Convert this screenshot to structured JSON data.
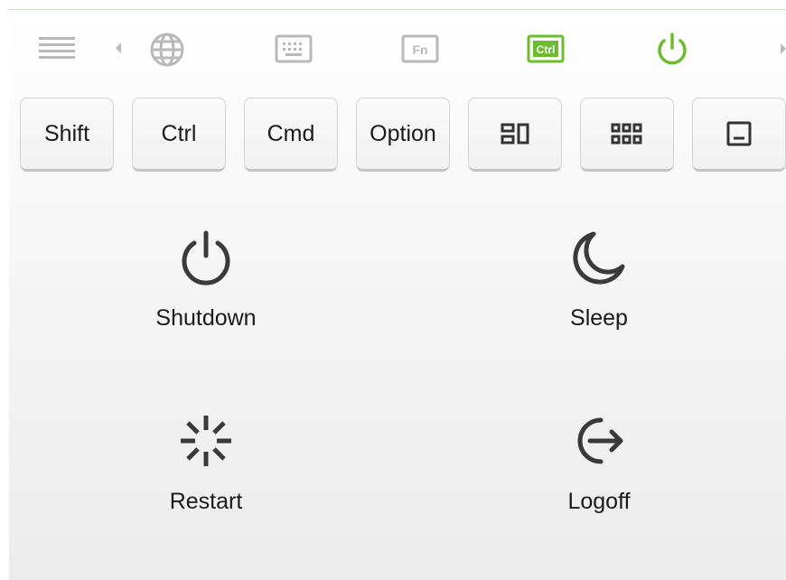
{
  "toolbar": {
    "icons": [
      "menu-icon",
      "chevron-left-icon",
      "globe-icon",
      "keyboard-icon",
      "fn-icon",
      "ctrl-icon",
      "power-icon",
      "chevron-right-icon"
    ],
    "fn_label": "Fn",
    "ctrl_label": "Ctrl",
    "active_color": "#6cbd2c",
    "inactive_color": "#b9b9b9"
  },
  "keys": {
    "shift": "Shift",
    "ctrl": "Ctrl",
    "cmd": "Cmd",
    "option": "Option",
    "icons": [
      "window-layout-icon",
      "grid-icon",
      "minimize-window-icon"
    ]
  },
  "power_options": {
    "shutdown": "Shutdown",
    "sleep": "Sleep",
    "restart": "Restart",
    "logoff": "Logoff"
  }
}
